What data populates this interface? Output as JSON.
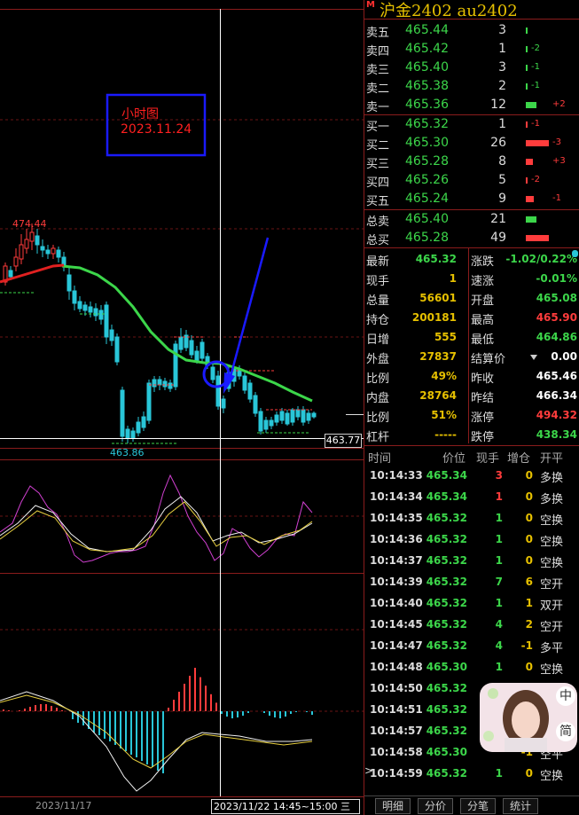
{
  "chart": {
    "annotation_line1": "小时图",
    "annotation_line2": "2023.11.24",
    "high_label": "474.44",
    "low_label": "463.86",
    "price_marker": "463.77",
    "date_left": "2023/11/17",
    "date_cursor": "2023/11/22 14:45~15:00 三",
    "colors": {
      "up": "#ff3c3c",
      "down": "#29c6d8",
      "ma": "#3cd64a",
      "accent": "#1a1aff"
    }
  },
  "header": {
    "mark": "M",
    "title": "沪金2402  au2402"
  },
  "orderbook": {
    "asks": [
      {
        "label": "卖五",
        "price": "465.44",
        "volume": "3",
        "change": ""
      },
      {
        "label": "卖四",
        "price": "465.42",
        "volume": "1",
        "change": "-2"
      },
      {
        "label": "卖三",
        "price": "465.40",
        "volume": "3",
        "change": "-1"
      },
      {
        "label": "卖二",
        "price": "465.38",
        "volume": "2",
        "change": "-1"
      },
      {
        "label": "卖一",
        "price": "465.36",
        "volume": "12",
        "change": "+2"
      }
    ],
    "bids": [
      {
        "label": "买一",
        "price": "465.32",
        "volume": "1",
        "change": "-1"
      },
      {
        "label": "买二",
        "price": "465.30",
        "volume": "26",
        "change": "-3"
      },
      {
        "label": "买三",
        "price": "465.28",
        "volume": "8",
        "change": "+3"
      },
      {
        "label": "买四",
        "price": "465.26",
        "volume": "5",
        "change": "-2"
      },
      {
        "label": "买五",
        "price": "465.24",
        "volume": "9",
        "change": "-1"
      }
    ],
    "totals": [
      {
        "label": "总卖",
        "price": "465.40",
        "volume": "21"
      },
      {
        "label": "总买",
        "price": "465.28",
        "volume": "49"
      }
    ]
  },
  "stats": {
    "left": [
      {
        "label": "最新",
        "value": "465.32"
      },
      {
        "label": "现手",
        "value": "1"
      },
      {
        "label": "总量",
        "value": "56601"
      },
      {
        "label": "持仓",
        "value": "200181"
      },
      {
        "label": "日增",
        "value": "555"
      },
      {
        "label": "外盘",
        "value": "27837"
      },
      {
        "label": "比例",
        "value": "49%"
      },
      {
        "label": "内盘",
        "value": "28764"
      },
      {
        "label": "比例",
        "value": "51%"
      },
      {
        "label": "杠杆",
        "value": "-----"
      }
    ],
    "right": [
      {
        "label": "涨跌",
        "value": "-1.02/0.22%"
      },
      {
        "label": "速涨",
        "value": "-0.01%"
      },
      {
        "label": "开盘",
        "value": "465.08"
      },
      {
        "label": "最高",
        "value": "465.90"
      },
      {
        "label": "最低",
        "value": "464.86"
      },
      {
        "label": "结算价",
        "value": "0.00"
      },
      {
        "label": "昨收",
        "value": "465.46"
      },
      {
        "label": "昨结",
        "value": "466.34"
      },
      {
        "label": "涨停",
        "value": "494.32"
      },
      {
        "label": "跌停",
        "value": "438.34"
      }
    ]
  },
  "ticks": {
    "headers": {
      "time": "时间",
      "price": "价位",
      "hand": "现手",
      "inc": "增仓",
      "kind": "开平"
    },
    "rows": [
      {
        "time": "10:14:33",
        "price": "465.34",
        "hand": "3",
        "inc": "0",
        "kind": "多换"
      },
      {
        "time": "10:14:34",
        "price": "465.34",
        "hand": "1",
        "inc": "0",
        "kind": "多换"
      },
      {
        "time": "10:14:35",
        "price": "465.32",
        "hand": "1",
        "inc": "0",
        "kind": "空换"
      },
      {
        "time": "10:14:36",
        "price": "465.32",
        "hand": "1",
        "inc": "0",
        "kind": "空换"
      },
      {
        "time": "10:14:37",
        "price": "465.32",
        "hand": "1",
        "inc": "0",
        "kind": "空换"
      },
      {
        "time": "10:14:39",
        "price": "465.32",
        "hand": "7",
        "inc": "6",
        "kind": "空开"
      },
      {
        "time": "10:14:40",
        "price": "465.32",
        "hand": "1",
        "inc": "1",
        "kind": "双开"
      },
      {
        "time": "10:14:45",
        "price": "465.32",
        "hand": "4",
        "inc": "2",
        "kind": "空开"
      },
      {
        "time": "10:14:47",
        "price": "465.32",
        "hand": "4",
        "inc": "-1",
        "kind": "多平"
      },
      {
        "time": "10:14:48",
        "price": "465.30",
        "hand": "1",
        "inc": "0",
        "kind": "空换"
      },
      {
        "time": "10:14:50",
        "price": "465.32",
        "hand": "",
        "inc": "",
        "kind": ""
      },
      {
        "time": "10:14:51",
        "price": "465.32",
        "hand": "",
        "inc": "",
        "kind": ""
      },
      {
        "time": "10:14:57",
        "price": "465.32",
        "hand": "",
        "inc": "",
        "kind": ""
      },
      {
        "time": "10:14:58",
        "price": "465.30",
        "hand": "",
        "inc": "-1",
        "kind": "空平"
      },
      {
        "time": "10:14:59",
        "price": "465.32",
        "hand": "1",
        "inc": "0",
        "kind": "空换"
      }
    ],
    "last_marker": ">"
  },
  "tabs": [
    "明细",
    "分价",
    "分笔",
    "统计"
  ],
  "float_widget": {
    "top_char": "中",
    "bottom_char": "简"
  }
}
